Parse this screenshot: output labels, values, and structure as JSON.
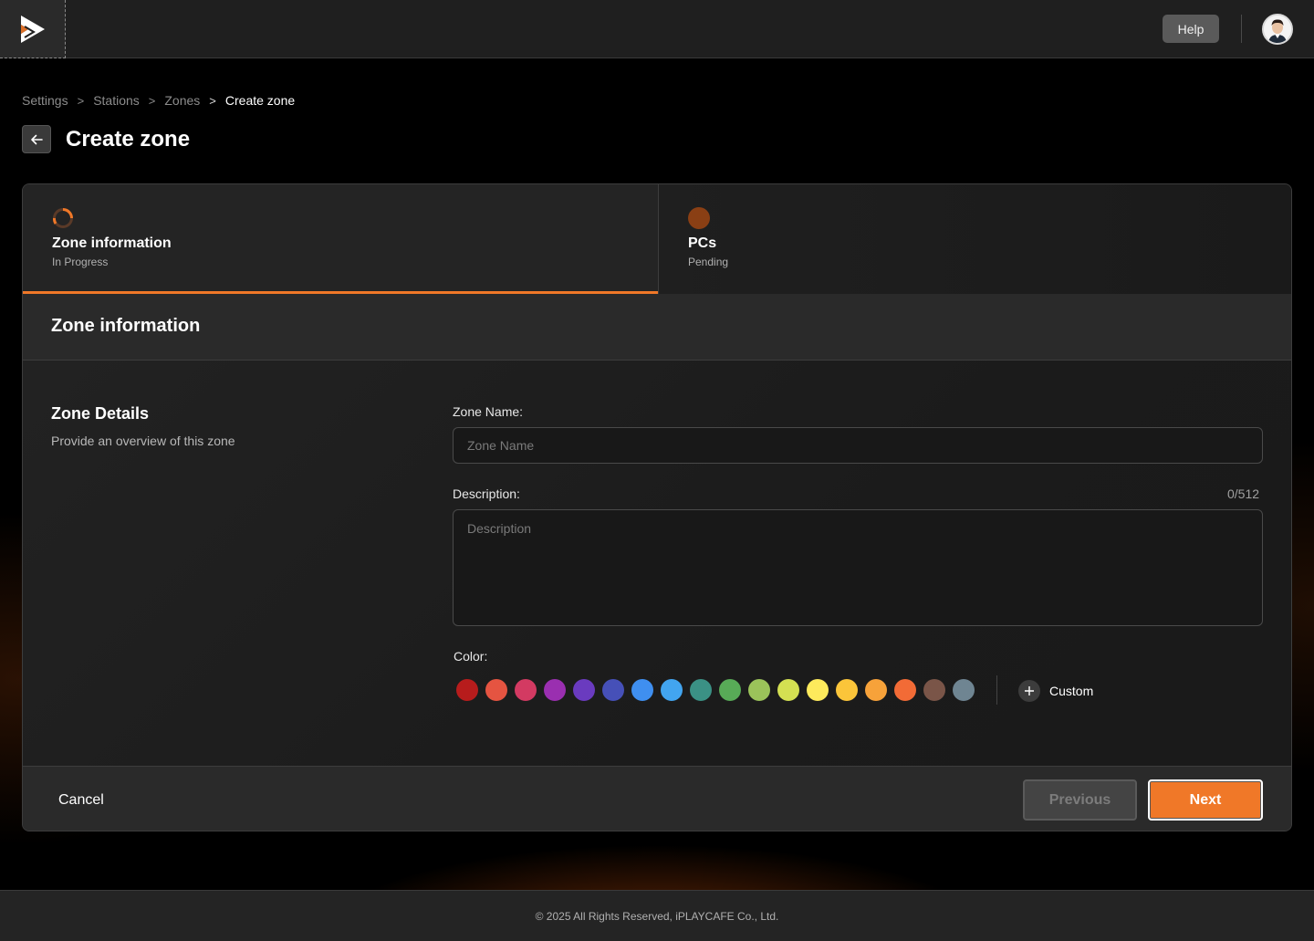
{
  "header": {
    "help_label": "Help",
    "logo": "play-logo-icon",
    "avatar": "user-avatar"
  },
  "breadcrumb": {
    "items": [
      "Settings",
      "Stations",
      "Zones"
    ],
    "current": "Create zone",
    "separator": ">"
  },
  "page": {
    "title": "Create zone"
  },
  "steps": [
    {
      "title": "Zone information",
      "status": "In Progress",
      "icon": "progress-spinner-icon"
    },
    {
      "title": "PCs",
      "status": "Pending",
      "icon": "pending-dot-icon"
    }
  ],
  "section": {
    "title": "Zone information",
    "details_title": "Zone Details",
    "details_subtitle": "Provide an overview of this zone"
  },
  "form": {
    "zone_name_label": "Zone Name:",
    "zone_name_placeholder": "Zone Name",
    "zone_name_value": "",
    "description_label": "Description:",
    "description_placeholder": "Description",
    "description_value": "",
    "description_counter": "0/512",
    "color_label": "Color:",
    "custom_label": "Custom",
    "colors": [
      "#b71c1c",
      "#e55441",
      "#d33a62",
      "#9a2fb0",
      "#6a3bbf",
      "#4650b8",
      "#3f8ff0",
      "#42a5f0",
      "#3b9185",
      "#58ab57",
      "#9bc35a",
      "#d4e052",
      "#fdea5c",
      "#fbc53a",
      "#f7a23a",
      "#f26b36",
      "#7a5548",
      "#6f8592"
    ]
  },
  "actions": {
    "cancel_label": "Cancel",
    "previous_label": "Previous",
    "next_label": "Next"
  },
  "footer": {
    "copyright": "© 2025 All Rights Reserved, iPLAYCAFE Co., Ltd."
  },
  "theme": {
    "accent": "#f07828"
  }
}
